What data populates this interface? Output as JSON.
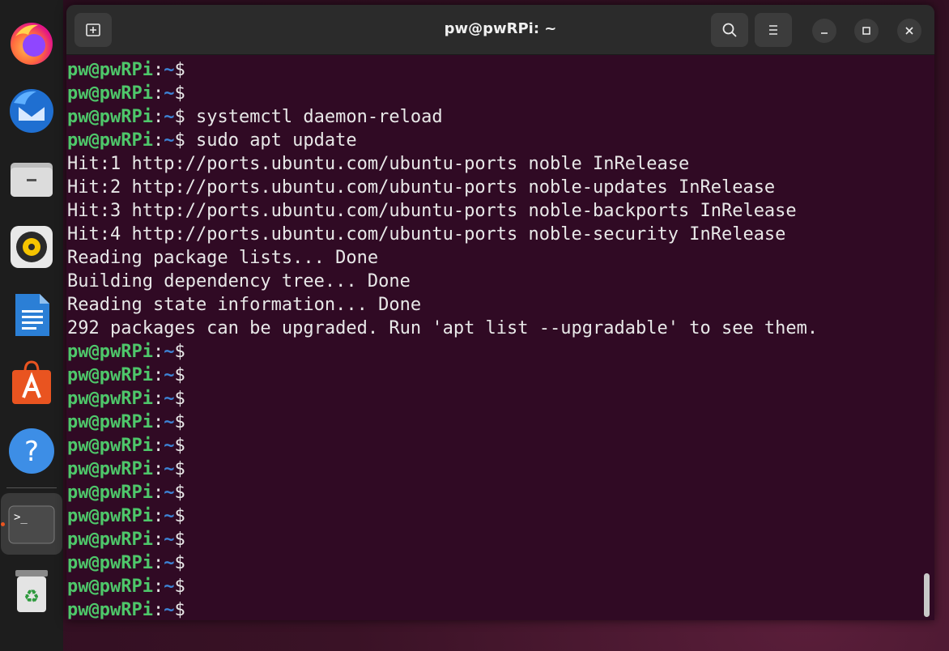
{
  "window": {
    "title": "pw@pwRPi: ~"
  },
  "dock": {
    "apps": [
      {
        "name": "firefox-icon"
      },
      {
        "name": "thunderbird-icon"
      },
      {
        "name": "files-icon"
      },
      {
        "name": "rhythmbox-icon"
      },
      {
        "name": "writer-icon"
      },
      {
        "name": "app-center-icon"
      },
      {
        "name": "help-icon"
      },
      {
        "name": "terminal-icon"
      },
      {
        "name": "trash-icon"
      }
    ]
  },
  "prompt": {
    "user": "pw@pwRPi",
    "sep": ":",
    "path": "~",
    "symbol": "$"
  },
  "lines": [
    {
      "type": "prompt",
      "cmd": ""
    },
    {
      "type": "prompt",
      "cmd": ""
    },
    {
      "type": "prompt",
      "cmd": " systemctl daemon-reload"
    },
    {
      "type": "prompt",
      "cmd": " sudo apt update"
    },
    {
      "type": "output",
      "text": "Hit:1 http://ports.ubuntu.com/ubuntu-ports noble InRelease"
    },
    {
      "type": "output",
      "text": "Hit:2 http://ports.ubuntu.com/ubuntu-ports noble-updates InRelease"
    },
    {
      "type": "output",
      "text": "Hit:3 http://ports.ubuntu.com/ubuntu-ports noble-backports InRelease"
    },
    {
      "type": "output",
      "text": "Hit:4 http://ports.ubuntu.com/ubuntu-ports noble-security InRelease"
    },
    {
      "type": "output",
      "text": "Reading package lists... Done"
    },
    {
      "type": "output",
      "text": "Building dependency tree... Done"
    },
    {
      "type": "output",
      "text": "Reading state information... Done"
    },
    {
      "type": "output",
      "text": "292 packages can be upgraded. Run 'apt list --upgradable' to see them."
    },
    {
      "type": "prompt",
      "cmd": ""
    },
    {
      "type": "prompt",
      "cmd": ""
    },
    {
      "type": "prompt",
      "cmd": ""
    },
    {
      "type": "prompt",
      "cmd": ""
    },
    {
      "type": "prompt",
      "cmd": ""
    },
    {
      "type": "prompt",
      "cmd": ""
    },
    {
      "type": "prompt",
      "cmd": ""
    },
    {
      "type": "prompt",
      "cmd": ""
    },
    {
      "type": "prompt",
      "cmd": ""
    },
    {
      "type": "prompt",
      "cmd": ""
    },
    {
      "type": "prompt",
      "cmd": ""
    },
    {
      "type": "prompt",
      "cmd": ""
    }
  ],
  "colors": {
    "terminal_bg": "#300a24",
    "prompt_user": "#4ec76a",
    "prompt_path": "#3d84d6",
    "accent": "#e95420"
  }
}
